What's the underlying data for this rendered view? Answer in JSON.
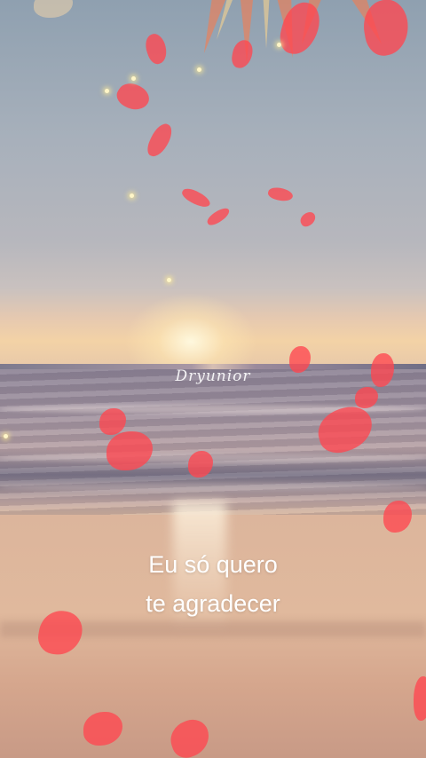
{
  "watermark": "Dryunior",
  "lyrics": {
    "line1": "Eu só quero",
    "line2": "te agradecer"
  },
  "colors": {
    "petal": "#ff4650",
    "text": "#ffffff"
  }
}
